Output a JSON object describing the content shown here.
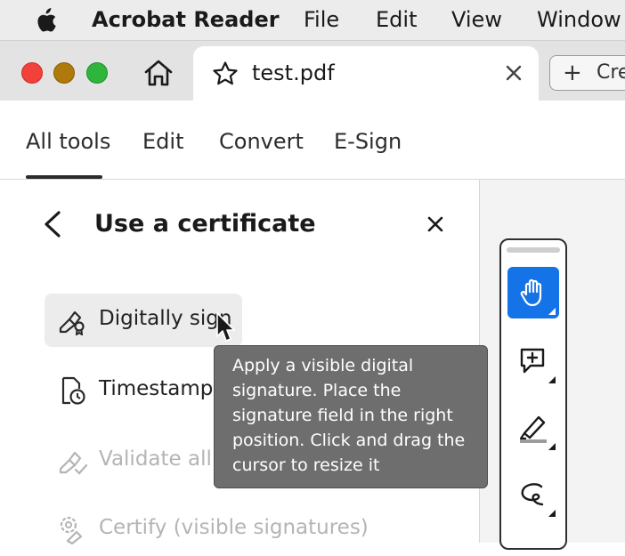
{
  "menubar": {
    "app_name": "Acrobat Reader",
    "items": [
      "File",
      "Edit",
      "View",
      "Window"
    ]
  },
  "tabbar": {
    "document_tab": "test.pdf",
    "create_button": "Cre"
  },
  "tool_tabs": {
    "items": [
      "All tools",
      "Edit",
      "Convert",
      "E-Sign"
    ],
    "selected": "All tools"
  },
  "panel": {
    "title": "Use a certificate",
    "actions": [
      {
        "label": "Digitally sign",
        "enabled": true
      },
      {
        "label": "Timestamp",
        "enabled": true
      },
      {
        "label": "Validate all s",
        "enabled": false
      },
      {
        "label": "Certify (visible signatures)",
        "enabled": false
      }
    ]
  },
  "tooltip": {
    "text": "Apply a visible digital signature. Place the signature field in the right position. Click and drag the cursor to resize it"
  },
  "colors": {
    "accent": "#1473e6",
    "tooltip_bg": "#6e6e6e",
    "disabled_text": "#b4b4b4"
  }
}
